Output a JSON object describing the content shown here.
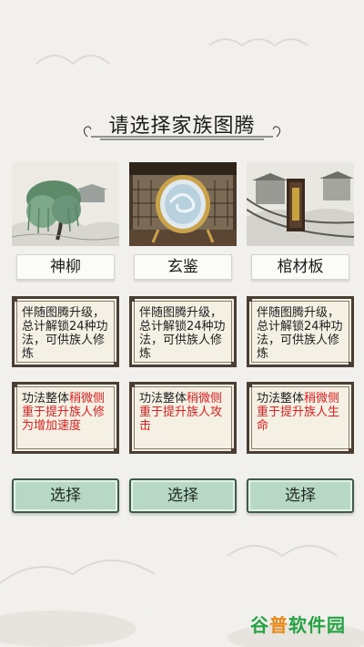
{
  "title": "请选择家族图腾",
  "totems": [
    {
      "name": "神柳",
      "art_icon": "willow-tree-icon",
      "description": "伴随图腾升级，总计解锁24种功法，可供族人修炼",
      "effect_prefix": "功法整体",
      "effect_highlight": "稍微侧重于提升族人修为增加速度",
      "button_label": "选择"
    },
    {
      "name": "玄鉴",
      "art_icon": "mirror-icon",
      "description": "伴随图腾升级，总计解锁24种功法，可供族人修炼",
      "effect_prefix": "功法整体",
      "effect_highlight_red": "稍微侧",
      "effect_tail": "重于提升族人攻击",
      "button_label": "选择"
    },
    {
      "name": "棺材板",
      "art_icon": "coffin-lid-icon",
      "description": "伴随图腾升级，总计解锁24种功法，可供族人修炼",
      "effect_prefix": "功法整体",
      "effect_highlight": "稍微侧重于提升族人生命",
      "button_label": "选择"
    }
  ],
  "watermark": {
    "part_a": "谷",
    "part_b": "普",
    "part_c": "软件园"
  },
  "colors": {
    "background": "#f1f0ec",
    "highlight_red": "#e02020",
    "box_border": "#4a3d33",
    "box_fill": "#f5f0e4",
    "button_fill": "#b7d8c5",
    "button_border": "#3e5b48"
  }
}
